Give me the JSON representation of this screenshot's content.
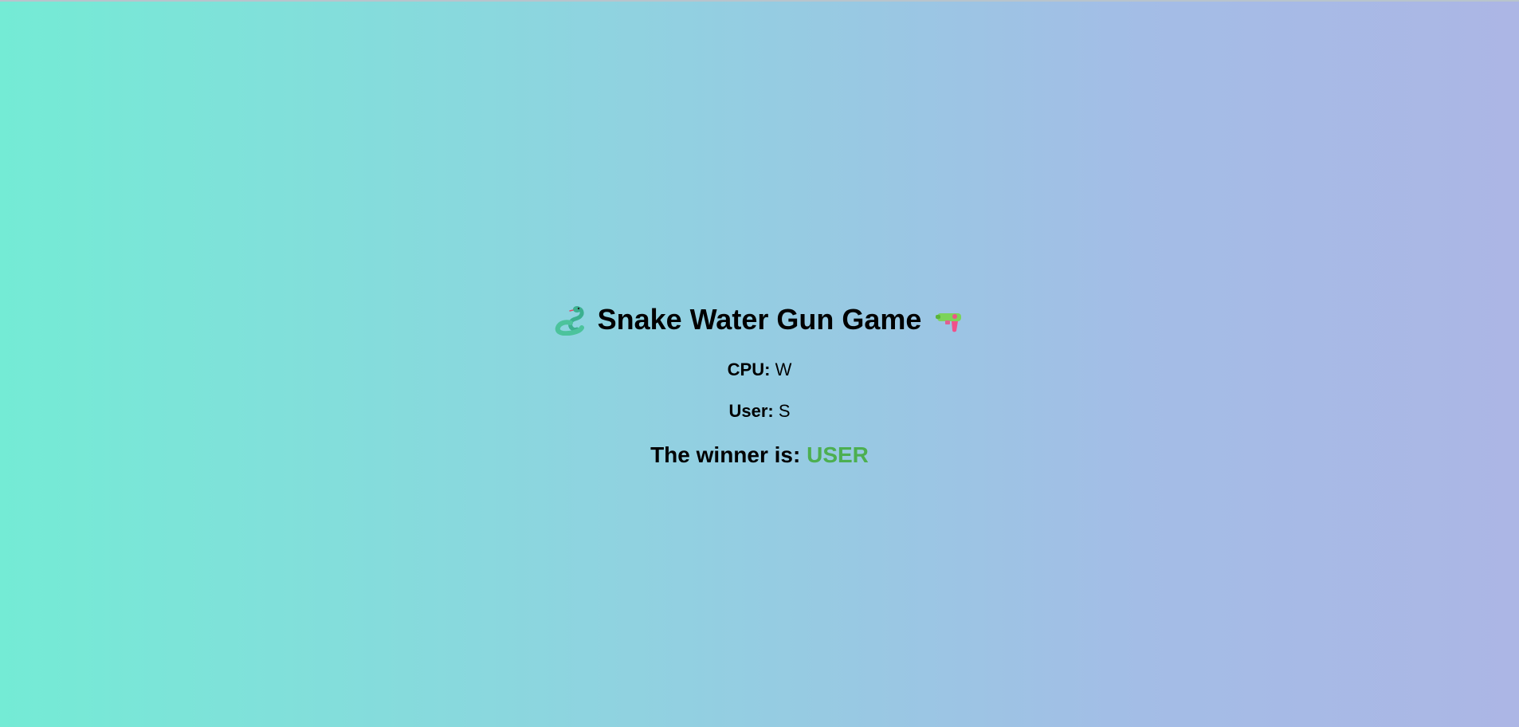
{
  "game": {
    "title": "Snake Water Gun Game",
    "title_left_icon": "snake-icon",
    "title_right_icon": "water-pistol-icon",
    "cpu_label": "CPU:",
    "cpu_choice": "W",
    "user_label": "User:",
    "user_choice": "S",
    "winner_label": "The winner is:",
    "winner_name": "USER",
    "winner_color": "#4caf50"
  }
}
